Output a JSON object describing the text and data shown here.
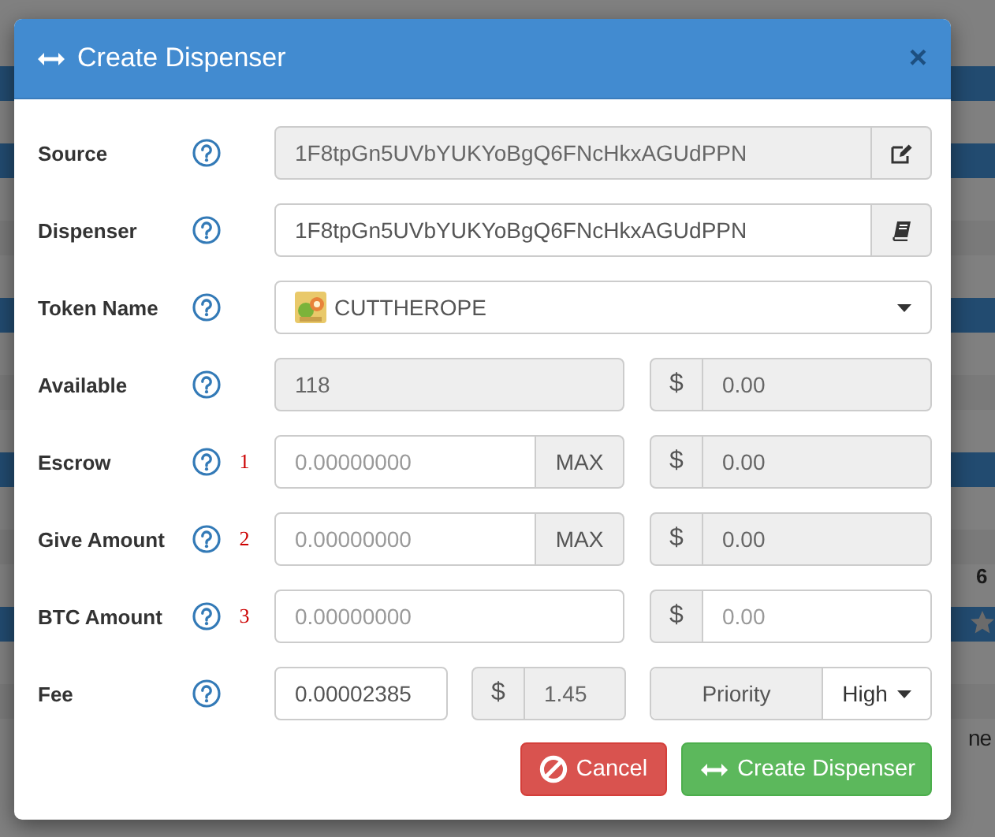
{
  "background": {
    "texts": [
      "6",
      "ne"
    ]
  },
  "dialog": {
    "title": "Create Dispenser",
    "close": "×"
  },
  "fields": [
    {
      "kind": "edit",
      "label": "Source",
      "value": "1F8tpGn5UVbYUKYoBgQ6FNcHkxAGUdPPN",
      "disabled": true
    },
    {
      "kind": "book",
      "label": "Dispenser",
      "value": "1F8tpGn5UVbYUKYoBgQ6FNcHkxAGUdPPN",
      "disabled": false
    },
    {
      "kind": "select",
      "label": "Token Name",
      "value": "CUTTHEROPE"
    },
    {
      "kind": "readonly",
      "label": "Available",
      "value": "118",
      "disabled": true,
      "usd_symbol": "$",
      "usd_value": "0.00",
      "usd_disabled": true
    },
    {
      "kind": "max",
      "label": "Escrow",
      "note": "1",
      "placeholder": "0.00000000",
      "disabled": false,
      "max": "MAX",
      "usd_symbol": "$",
      "usd_value": "0.00",
      "usd_disabled": true
    },
    {
      "kind": "max",
      "label": "Give Amount",
      "note": "2",
      "placeholder": "0.00000000",
      "disabled": false,
      "max": "MAX",
      "usd_symbol": "$",
      "usd_value": "0.00",
      "usd_disabled": true
    },
    {
      "kind": "plain",
      "label": "BTC Amount",
      "note": "3",
      "placeholder": "0.00000000",
      "disabled": false,
      "usd_symbol": "$",
      "usd_placeholder": "0.00",
      "usd_disabled": false
    },
    {
      "kind": "fee",
      "label": "Fee",
      "value": "0.00002385",
      "disabled": false,
      "usd_symbol": "$",
      "usd_value": "1.45",
      "usd_disabled": true,
      "priority_label": "Priority",
      "priority_value": "High"
    }
  ],
  "buttons": [
    {
      "kind": "cancel",
      "label": "Cancel"
    },
    {
      "kind": "create",
      "label": "Create Dispenser"
    }
  ]
}
